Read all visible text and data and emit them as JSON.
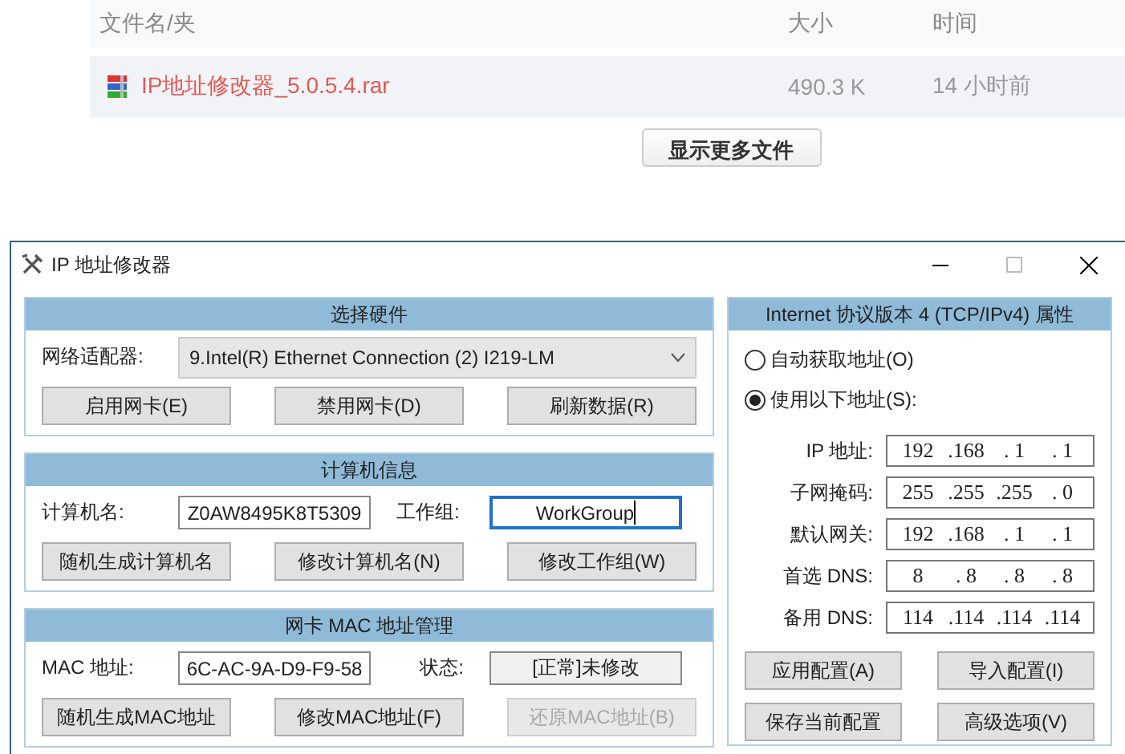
{
  "file_list": {
    "columns": [
      "文件名/夹",
      "大小",
      "时间"
    ],
    "rows": [
      {
        "name": "IP地址修改器_5.0.5.4.rar",
        "size": "490.3 K",
        "time": "14 小时前"
      }
    ],
    "more_button": "显示更多文件"
  },
  "window": {
    "title": "IP 地址修改器",
    "sections": [
      {
        "title": "选择硬件",
        "fields": [
          {
            "kind": "dropdown",
            "label": "网络适配器:",
            "value": "9.Intel(R) Ethernet Connection (2) I219-LM"
          }
        ],
        "buttons": [
          {
            "label": "启用网卡(E)",
            "disabled": false
          },
          {
            "label": "禁用网卡(D)",
            "disabled": false
          },
          {
            "label": "刷新数据(R)",
            "disabled": false
          }
        ]
      },
      {
        "title": "计算机信息",
        "fields": [
          {
            "kind": "input",
            "label": "计算机名:",
            "value": "Z0AW8495K8T5309",
            "focused": false
          },
          {
            "kind": "input",
            "label": "工作组:",
            "value": "WorkGroup",
            "focused": true
          }
        ],
        "buttons": [
          {
            "label": "随机生成计算机名",
            "disabled": false
          },
          {
            "label": "修改计算机名(N)",
            "disabled": false
          },
          {
            "label": "修改工作组(W)",
            "disabled": false
          }
        ]
      },
      {
        "title": "网卡 MAC 地址管理",
        "fields": [
          {
            "kind": "input",
            "label": "MAC 地址:",
            "value": "6C-AC-9A-D9-F9-58",
            "focused": false
          },
          {
            "kind": "status",
            "label": "状态:",
            "value": "[正常]未修改"
          }
        ],
        "buttons": [
          {
            "label": "随机生成MAC地址",
            "disabled": false
          },
          {
            "label": "修改MAC地址(F)",
            "disabled": false
          },
          {
            "label": "还原MAC地址(B)",
            "disabled": true
          }
        ]
      }
    ],
    "ipv4": {
      "title": "Internet 协议版本 4 (TCP/IPv4) 属性",
      "radios": [
        {
          "label": "自动获取地址(O)",
          "selected": false
        },
        {
          "label": "使用以下地址(S):",
          "selected": true
        }
      ],
      "fields": [
        {
          "label": "IP 地址:",
          "octets": [
            "192",
            ".168",
            ". 1",
            ". 1"
          ]
        },
        {
          "label": "子网掩码:",
          "octets": [
            "255",
            ".255",
            ".255",
            ". 0"
          ]
        },
        {
          "label": "默认网关:",
          "octets": [
            "192",
            ".168",
            ". 1",
            ". 1"
          ]
        },
        {
          "label": "首选 DNS:",
          "octets": [
            "8",
            ". 8",
            ". 8",
            ". 8"
          ]
        },
        {
          "label": "备用 DNS:",
          "octets": [
            "114",
            ".114",
            ".114",
            ".114"
          ]
        }
      ],
      "buttons": [
        {
          "label": "应用配置(A)"
        },
        {
          "label": "导入配置(I)"
        },
        {
          "label": "保存当前配置"
        },
        {
          "label": "高级选项(V)"
        }
      ]
    }
  }
}
